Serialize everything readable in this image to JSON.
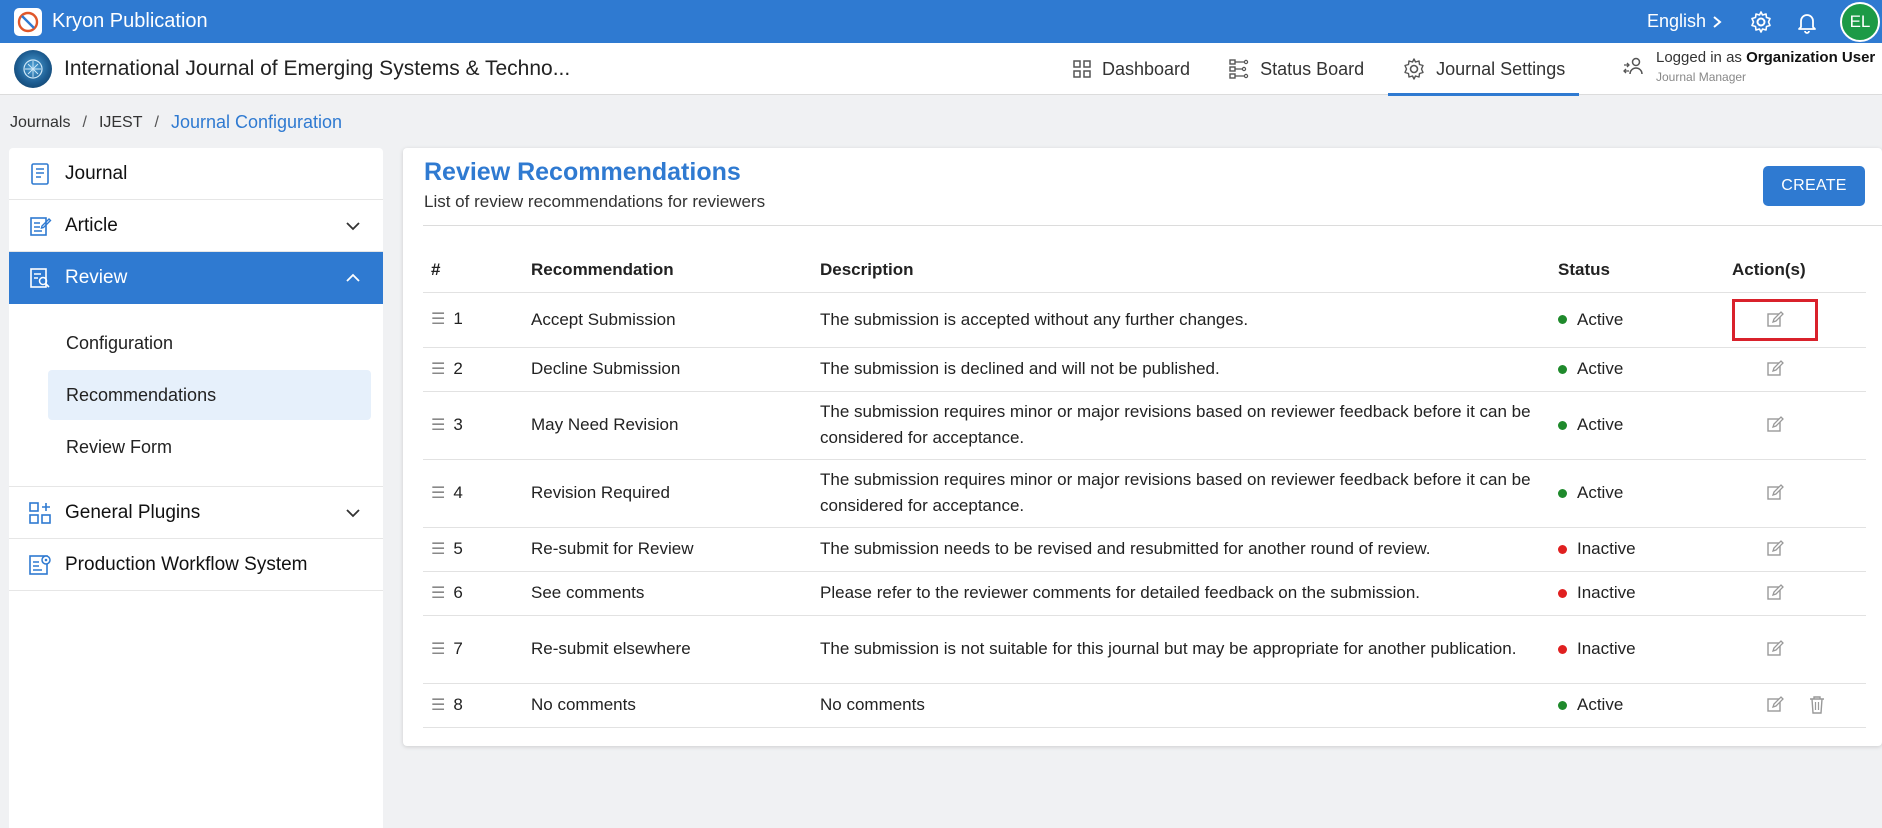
{
  "app": {
    "name": "Kryon Publication",
    "language": "English",
    "avatar_initials": "EL"
  },
  "journal": {
    "title": "International Journal of Emerging Systems & Techno..."
  },
  "nav": {
    "items": [
      {
        "label": "Dashboard",
        "icon": "dashboard-icon"
      },
      {
        "label": "Status Board",
        "icon": "status-board-icon"
      },
      {
        "label": "Journal Settings",
        "icon": "gear-icon"
      }
    ],
    "active_index": 2
  },
  "user": {
    "logged_prefix": "Logged in as ",
    "name": "Organization User",
    "role": "Journal Manager"
  },
  "breadcrumb": {
    "items": [
      "Journals",
      "IJEST",
      "Journal Configuration"
    ]
  },
  "sidebar": {
    "items": [
      {
        "label": "Journal",
        "icon": "journal-icon"
      },
      {
        "label": "Article",
        "icon": "article-icon"
      },
      {
        "label": "Review",
        "icon": "review-icon"
      },
      {
        "label": "General Plugins",
        "icon": "plugins-icon"
      },
      {
        "label": "Production Workflow System",
        "icon": "workflow-icon"
      }
    ],
    "review_sub": [
      "Configuration",
      "Recommendations",
      "Review Form"
    ]
  },
  "main": {
    "title": "Review Recommendations",
    "subtitle": "List of review recommendations for reviewers",
    "create_label": "CREATE",
    "columns": [
      "#",
      "Recommendation",
      "Description",
      "Status",
      "Action(s)"
    ],
    "rows": [
      {
        "num": "1",
        "recommendation": "Accept Submission",
        "description": "The submission is accepted without any further changes.",
        "status": "Active"
      },
      {
        "num": "2",
        "recommendation": "Decline Submission",
        "description": "The submission is declined and will not be published.",
        "status": "Active"
      },
      {
        "num": "3",
        "recommendation": "May Need Revision",
        "description": "The submission requires minor or major revisions based on reviewer feedback before it can be considered for acceptance.",
        "status": "Active"
      },
      {
        "num": "4",
        "recommendation": "Revision Required",
        "description": "The submission requires minor or major revisions based on reviewer feedback before it can be considered for acceptance.",
        "status": "Active"
      },
      {
        "num": "5",
        "recommendation": "Re-submit for Review",
        "description": "The submission needs to be revised and resubmitted for another round of review.",
        "status": "Inactive"
      },
      {
        "num": "6",
        "recommendation": "See comments",
        "description": "Please refer to the reviewer comments for detailed feedback on the submission.",
        "status": "Inactive"
      },
      {
        "num": "7",
        "recommendation": "Re-submit elsewhere",
        "description": "The submission is not suitable for this journal but may be appropriate for another publication.",
        "status": "Inactive"
      },
      {
        "num": "8",
        "recommendation": "No comments",
        "description": "No comments",
        "status": "Active"
      }
    ]
  },
  "colors": {
    "primary": "#2f7ad1",
    "active_dot": "#1f8a2c",
    "inactive_dot": "#e02020",
    "highlight_box": "#d9212b"
  }
}
